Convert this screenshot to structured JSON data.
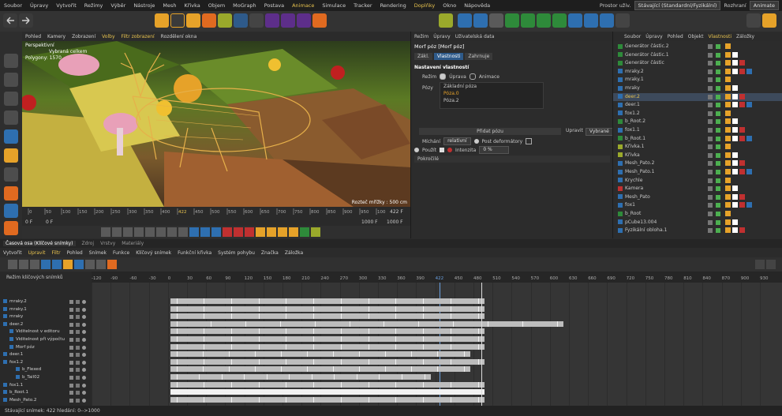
{
  "menu": [
    "Soubor",
    "Úpravy",
    "Vytvořit",
    "Režimy",
    "Výběr",
    "Nástroje",
    "Mesh",
    "Křivka",
    "Objem",
    "MoGraph",
    "Postava",
    "Animace",
    "Simulace",
    "Tracker",
    "Rendering",
    "Doplňky",
    "Okno",
    "Nápověda"
  ],
  "menu_highlight": [
    "Animace",
    "Doplňky"
  ],
  "layout": {
    "label": "Prostor uživ.",
    "value": "Stávající (Standardní/Fyzikální)",
    "iface_label": "Rozhraní",
    "iface_value": "Animate"
  },
  "viewport": {
    "menu": [
      "Pohled",
      "Kamery",
      "Zobrazení",
      "Volby",
      "Filtr zobrazení",
      "Rozdělení okna"
    ],
    "labels": [
      "Perspektivní",
      "Vybraná celkem",
      "Polygony: 1570"
    ],
    "grid_text": "Rozteč mřížky : 500 cm"
  },
  "timeline": {
    "ticks": [
      "0",
      "50",
      "100",
      "150",
      "200",
      "250",
      "300",
      "350",
      "400",
      "422",
      "450",
      "500",
      "550",
      "600",
      "650",
      "700",
      "750",
      "800",
      "850",
      "900",
      "950",
      "100"
    ],
    "current": "422 F",
    "start": "0 F",
    "start2": "0 F",
    "end": "1000 F",
    "end2": "1000 F"
  },
  "attributes": {
    "menu": [
      "Režim",
      "Úpravy",
      "Uživatelská data"
    ],
    "title": "Morf póz [Morf póz]",
    "tabs": [
      "Zákl.",
      "Vlastnosti",
      "Zahrnuje"
    ],
    "section": "Nastavení vlastností",
    "mode_label": "Režim",
    "mode_opts": [
      "Úprava",
      "Animace"
    ],
    "poses_label": "Pózy",
    "poses": [
      "Základní póza",
      "Póza.0",
      "Póza.2"
    ],
    "add_pose": "Přidat pózu",
    "edit_label": "Upravit",
    "edit_value": "Vybrané",
    "mix_label": "Míchání",
    "mix_value": "relativní",
    "post_deformers": "Post deformátory",
    "use_label": "Použít",
    "strength_label": "Intenzita",
    "strength_value": "0 %",
    "advanced": "Pokročilé"
  },
  "objects": {
    "menu": [
      "Soubor",
      "Úpravy",
      "Pohled",
      "Objekt",
      "Vlastnosti",
      "Záložky"
    ],
    "items": [
      "Generátor částic.2",
      "Generátor částic.1",
      "Generátor částic",
      "mraky.2",
      "mraky.1",
      "mraky",
      "deer.2",
      "deer.1",
      "fox1.2",
      "b_Root.2",
      "fox1.1",
      "b_Root.1",
      "Křivka.1",
      "Křivka",
      "Mesh_Pato.2",
      "Mesh_Pato.1",
      "Krychle",
      "Kamera",
      "Mesh_Pato",
      "fox1",
      "b_Root",
      "pCube13.004",
      "Fyzikální obloha.1"
    ]
  },
  "timeline_mgr": {
    "tabs": [
      "Časová osa (Klíčové snímky)",
      "Zdroj",
      "Vrstvy",
      "Materiály"
    ],
    "menu": [
      "Vytvořit",
      "Upravit",
      "Filtr",
      "Pohled",
      "Snímek",
      "Funkce",
      "Klíčový snímek",
      "Funkční křivka",
      "Systém pohybu",
      "Značka",
      "Záložka"
    ],
    "mode_label": "Režim klíčových snímků",
    "ruler": [
      "-120",
      "-90",
      "-60",
      "-30",
      "0",
      "30",
      "60",
      "90",
      "120",
      "150",
      "180",
      "210",
      "240",
      "270",
      "300",
      "330",
      "360",
      "390",
      "422",
      "450",
      "480",
      "510",
      "540",
      "570",
      "600",
      "630",
      "660",
      "690",
      "720",
      "750",
      "780",
      "810",
      "840",
      "870",
      "900",
      "930"
    ],
    "tracks": [
      "mraky.2",
      "mraky.1",
      "mraky",
      "deer.2",
      "Viditelnost v editoru",
      "Viditelnost při výpočtu",
      "Morf póz",
      "deer.1",
      "fox1.2",
      "b_Flexed",
      "b_Tail02",
      "fox1.1",
      "b_Root.1",
      "Mesh_Pato.2"
    ]
  },
  "status": "Stávající snímek: 422  hledání: 0-->1000"
}
